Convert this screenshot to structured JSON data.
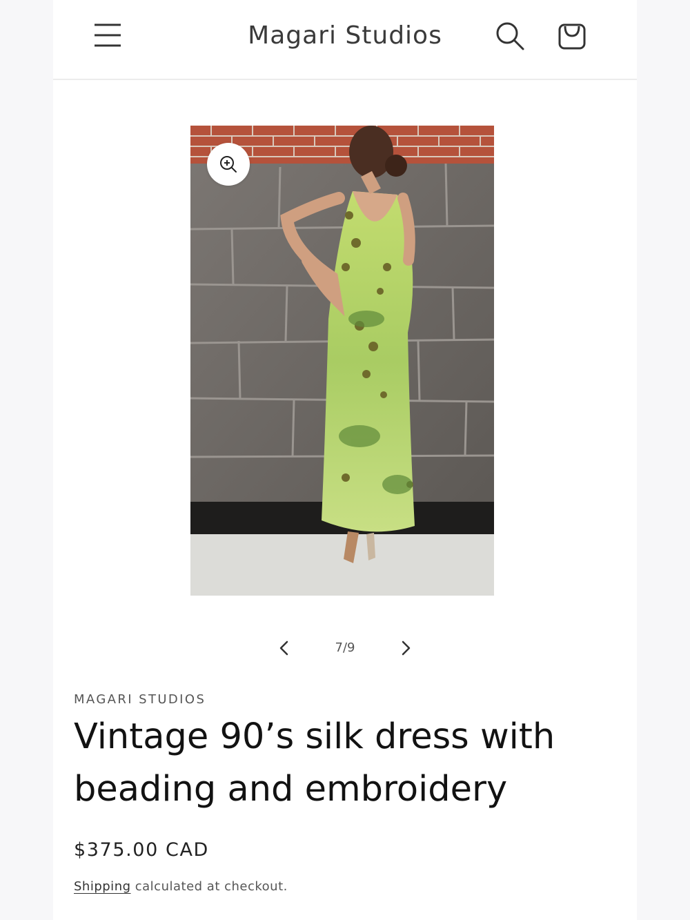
{
  "header": {
    "brand": "Magari Studios",
    "menu_icon": "hamburger-menu-icon",
    "search_icon": "search-icon",
    "cart_icon": "shopping-bag-icon"
  },
  "gallery": {
    "zoom_icon": "zoom-in-icon",
    "counter": "7/9",
    "prev_icon": "chevron-left-icon",
    "next_icon": "chevron-right-icon",
    "image_description_colors": {
      "brick": "#b5523b",
      "stone": "#6f6a66",
      "dress": "#b6d36a",
      "sidewalk": "#dcdcd8"
    }
  },
  "product": {
    "vendor": "MAGARI STUDIOS",
    "title": "Vintage 90’s silk dress with beading and embroidery",
    "price": "$375.00 CAD",
    "shipping_link": "Shipping",
    "shipping_rest": " calculated at checkout."
  }
}
